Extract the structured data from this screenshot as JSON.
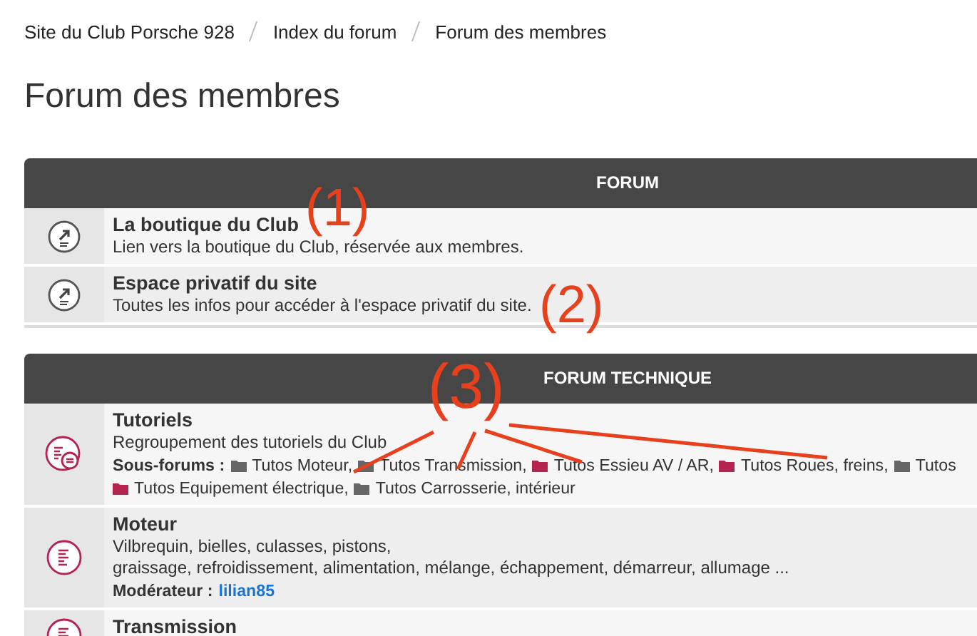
{
  "breadcrumbs": [
    "Site du Club Porsche 928",
    "Index du forum",
    "Forum des membres"
  ],
  "title": "Forum des membres",
  "sections": [
    {
      "header": "FORUM",
      "rows": [
        {
          "kind": "link",
          "name": "La boutique du Club",
          "description": [
            "Lien vers la boutique du Club, réservée aux membres."
          ]
        },
        {
          "kind": "link",
          "name": "Espace privatif du site",
          "description": [
            "Toutes les infos pour accéder à l'espace privatif du site."
          ]
        }
      ]
    },
    {
      "header": "FORUM TECHNIQUE",
      "rows": [
        {
          "kind": "subforums",
          "name": "Tutoriels",
          "description": [
            "Regroupement des tutoriels du Club"
          ],
          "subforums_label": "Sous-forums :",
          "subforum_lines": [
            [
              {
                "name": "Tutos Moteur,",
                "color": "#666666"
              },
              {
                "name": "Tutos Transmission,",
                "color": "#666666"
              },
              {
                "name": "Tutos Essieu AV / AR,",
                "color": "#b5234f"
              },
              {
                "name": "Tutos Roues, freins,",
                "color": "#b5234f"
              },
              {
                "name": "Tutos",
                "color": "#666666"
              }
            ],
            [
              {
                "name": "Tutos Equipement électrique,",
                "color": "#b5234f"
              },
              {
                "name": "Tutos Carrosserie, intérieur",
                "color": "#666666"
              }
            ]
          ]
        },
        {
          "kind": "forum",
          "name": "Moteur",
          "description": [
            "Vilbrequin, bielles, culasses, pistons,",
            "graissage, refroidissement, alimentation, mélange, échappement, démarreur, allumage ..."
          ],
          "moderator_label": "Modérateur :",
          "moderator": "lilian85"
        },
        {
          "kind": "forum",
          "name": "Transmission",
          "description": []
        }
      ]
    }
  ],
  "annotations": [
    "(1)",
    "(2)",
    "(3)"
  ]
}
